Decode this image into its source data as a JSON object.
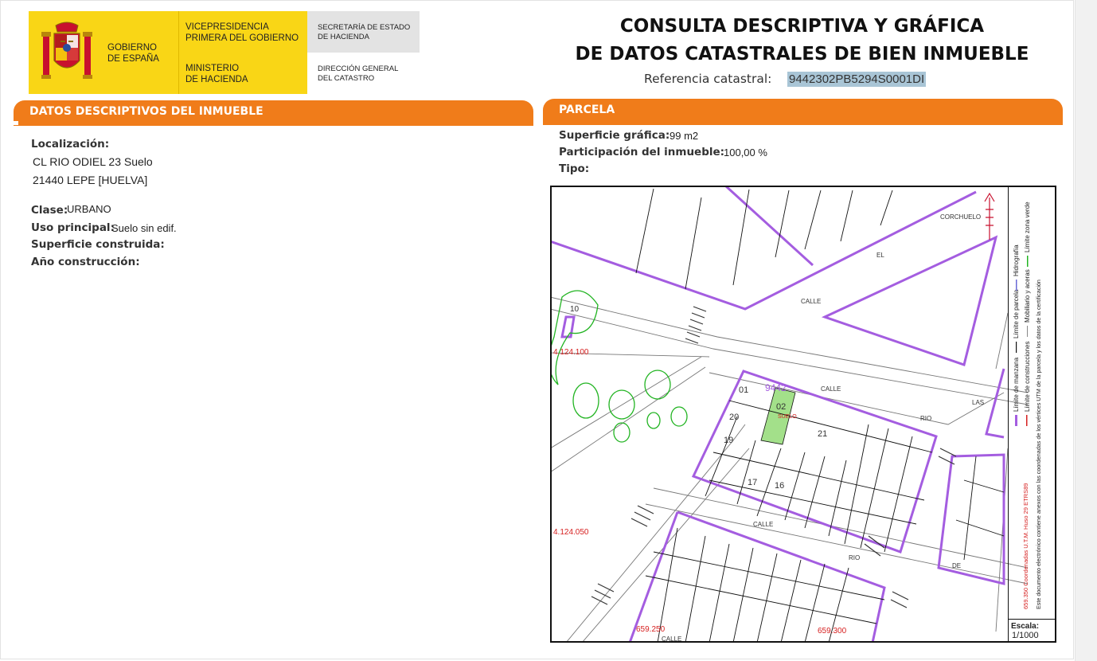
{
  "header": {
    "gov_line1": "GOBIERNO",
    "gov_line2": "DE ESPAÑA",
    "vice_line1": "VICEPRESIDENCIA",
    "vice_line2": "PRIMERA DEL GOBIERNO",
    "min_line1": "MINISTERIO",
    "min_line2": "DE HACIENDA",
    "sec_line1": "SECRETARÍA DE ESTADO",
    "sec_line2": "DE HACIENDA",
    "dir_line1": "DIRECCIÓN GENERAL",
    "dir_line2": "DEL CATASTRO",
    "brand_yellow": "#f9d616",
    "brand_red": "#c8102e"
  },
  "title": {
    "line1": "CONSULTA DESCRIPTIVA Y GRÁFICA",
    "line2": "DE DATOS CATASTRALES DE BIEN INMUEBLE",
    "ref_label": "Referencia catastral:",
    "ref_value": "9442302PB5294S0001DI"
  },
  "descriptivos": {
    "header": "DATOS DESCRIPTIVOS DEL INMUEBLE",
    "localizacion_label": "Localización:",
    "localizacion_line1": "CL RIO ODIEL 23 Suelo",
    "localizacion_line2": "21440 LEPE [HUELVA]",
    "clase_label": "Clase:",
    "clase_value": "URBANO",
    "uso_label": "Uso principal:",
    "uso_value": "Suelo sin edif.",
    "superficie_label": "Superficie construida:",
    "anio_label": "Año construcción:"
  },
  "parcela": {
    "header": "PARCELA",
    "sup_label": "Superficie gráfica:",
    "sup_value": "99 m2",
    "part_label": "Participación del inmueble:",
    "part_value": "100,00 %",
    "tipo_label": "Tipo:",
    "accent": "#f07c1a"
  },
  "map": {
    "labels": {
      "coord_y1": "4.124.100",
      "coord_y2": "4.124.050",
      "coord_x1": "659.250",
      "coord_x2": "659.300",
      "ref_partial": "9442",
      "suelo": "SUELO",
      "street_calle": "CALLE",
      "street_corchuelo": "CORCHUELO",
      "street_el": "EL",
      "street_rio": "RIO",
      "street_las": "LAS",
      "street_de": "DE",
      "n_10_top": "10",
      "n_01": "01",
      "n_02": "02",
      "n_20": "20",
      "n_19": "19",
      "n_21": "21",
      "n_17": "17",
      "n_16": "16"
    },
    "colors": {
      "block_line": "#a45de0",
      "building_line": "#111111",
      "green": "#22b422",
      "parcel_fill": "#a3e08a",
      "coord_red": "#d62020",
      "number_blue": "#2a2ab0"
    }
  },
  "legend": {
    "col1_a": "Límite de manzana",
    "col1_b": "Límite de parcela",
    "col1_c": "Hidrografía",
    "col2_a": "Límite de construcciones",
    "col2_b": "Mobiliario y aceras",
    "col2_c": "Límite zona verde",
    "utm": "659.350 Coordenadas U.T.M. Huso 29 ETRS89",
    "note": "Este documento electrónico contiene anexos con las coordenadas de los vértices UTM de la parcela y los datos de la certificación",
    "scale_label": "Escala:",
    "scale_value": "1/1000"
  }
}
